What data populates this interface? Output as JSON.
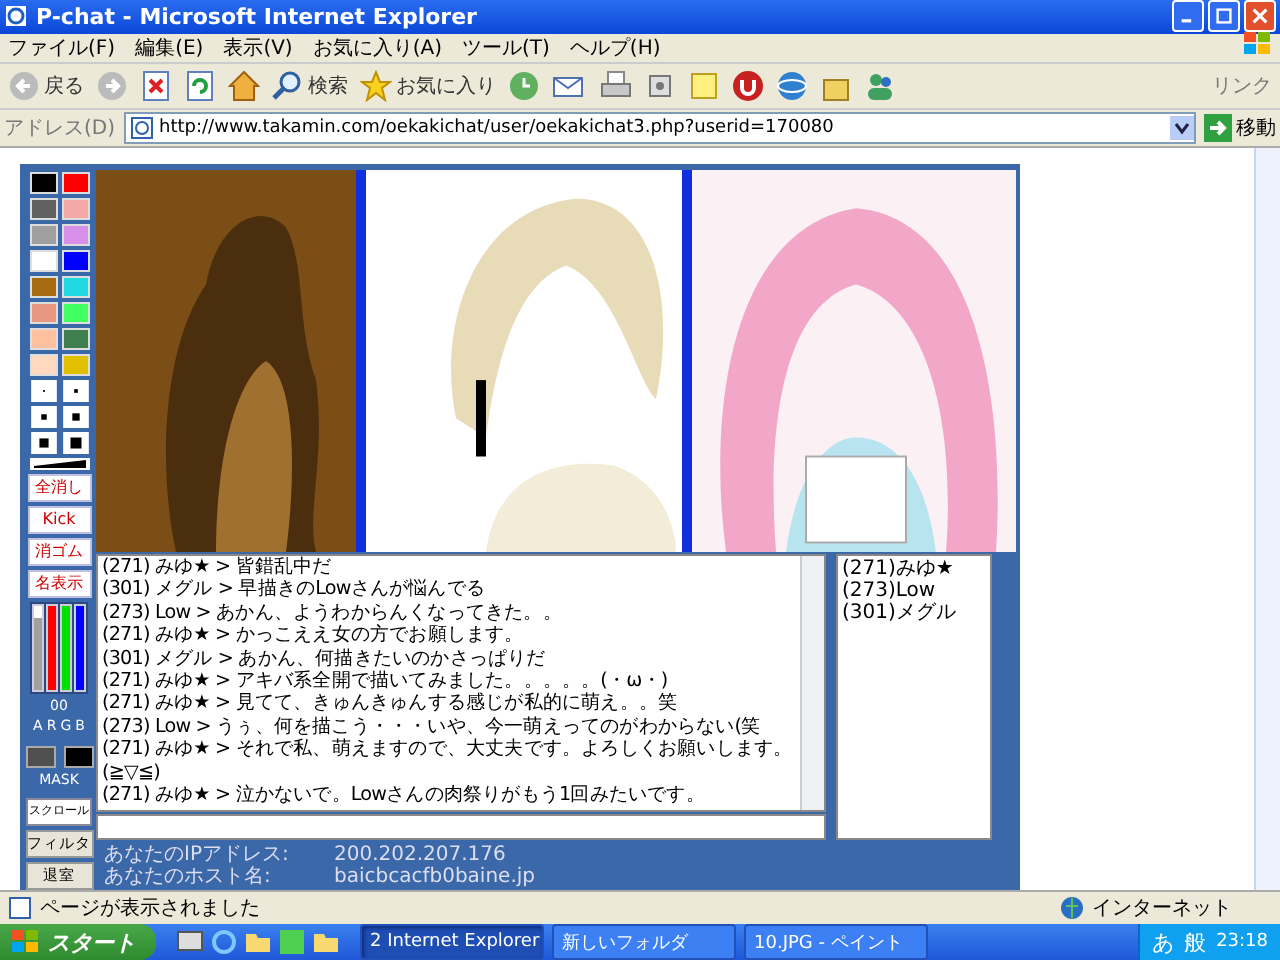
{
  "window": {
    "title": "P-chat - Microsoft Internet Explorer"
  },
  "menu": [
    "ファイル(F)",
    "編集(E)",
    "表示(V)",
    "お気に入り(A)",
    "ツール(T)",
    "ヘルプ(H)"
  ],
  "toolbar": {
    "back": "戻る",
    "search": "検索",
    "favorites": "お気に入り",
    "links": "リンク"
  },
  "address": {
    "label": "アドレス(D)",
    "url": "http://www.takamin.com/oekakichat/user/oekakichat3.php?userid=170080",
    "go": "移動"
  },
  "applet": {
    "palette": [
      {
        "color": "#000000"
      },
      {
        "color": "#ff0000"
      },
      {
        "color": "#606060"
      },
      {
        "color": "#f4a8a8"
      },
      {
        "color": "#a0a0a0"
      },
      {
        "color": "#d890e8"
      },
      {
        "color": "#ffffff"
      },
      {
        "color": "#0000ff"
      },
      {
        "color": "#a86c10"
      },
      {
        "color": "#20d8e0"
      },
      {
        "color": "#e89880"
      },
      {
        "color": "#40ff60"
      },
      {
        "color": "#ffc0a0"
      },
      {
        "color": "#408050"
      },
      {
        "color": "#ffd8c0"
      },
      {
        "color": "#e0c000"
      }
    ],
    "tools": [
      "全消し",
      "Kick",
      "消ゴム",
      "名表示"
    ],
    "sliders": [
      {
        "label": "A",
        "color": "#a0a0a0",
        "level": 0.85
      },
      {
        "label": "R",
        "color": "#ff0000",
        "level": 1
      },
      {
        "label": "G",
        "color": "#00e000",
        "level": 1
      },
      {
        "label": "B",
        "color": "#0000ff",
        "level": 1
      }
    ],
    "slider_value": "00",
    "mask_label": "MASK",
    "scroll_button": "スクロール",
    "filter_button": "フィルタ",
    "exit_button": "退室",
    "chat_log": [
      "(271) みゆ★ > 皆錯乱中だ",
      "(301) メグル > 早描きのLowさんが悩んでる",
      "(273) Low > あかん、ようわからんくなってきた。。",
      "(271) みゆ★ > かっこええ女の方でお願します。",
      "(301) メグル > あかん、何描きたいのかさっぱりだ",
      "(271) みゆ★ > アキバ系全開で描いてみました。。。。。(・ω・)",
      "(271) みゆ★ > 見てて、きゅんきゅんする感じが私的に萌え。。笑",
      "(273) Low > うぅ、何を描こう・・・いや、今一萌えってのがわからない(笑",
      "(271) みゆ★ > それで私、萌えますので、大丈夫です。よろしくお願いします。(≧▽≦)",
      "(271) みゆ★ > 泣かないで。Lowさんの肉祭りがもう1回みたいです。"
    ],
    "users": [
      "(271)みゆ★",
      "(273)Low",
      "(301)メグル"
    ],
    "info": [
      {
        "label": "あなたのIPアドレス:",
        "value": "200.202.207.176"
      },
      {
        "label": "あなたのホスト名:",
        "value": "baicbcacfb0baine.jp"
      }
    ]
  },
  "status": {
    "text": "ページが表示されました",
    "zone": "インターネット"
  },
  "taskbar": {
    "start": "スタート",
    "tasks": [
      {
        "label": "2 Internet Explorer",
        "selected": true
      },
      {
        "label": "新しいフォルダ",
        "selected": false
      },
      {
        "label": "10.JPG - ペイント",
        "selected": false
      }
    ],
    "ime": [
      "あ",
      "般"
    ],
    "clock": "23:18"
  }
}
